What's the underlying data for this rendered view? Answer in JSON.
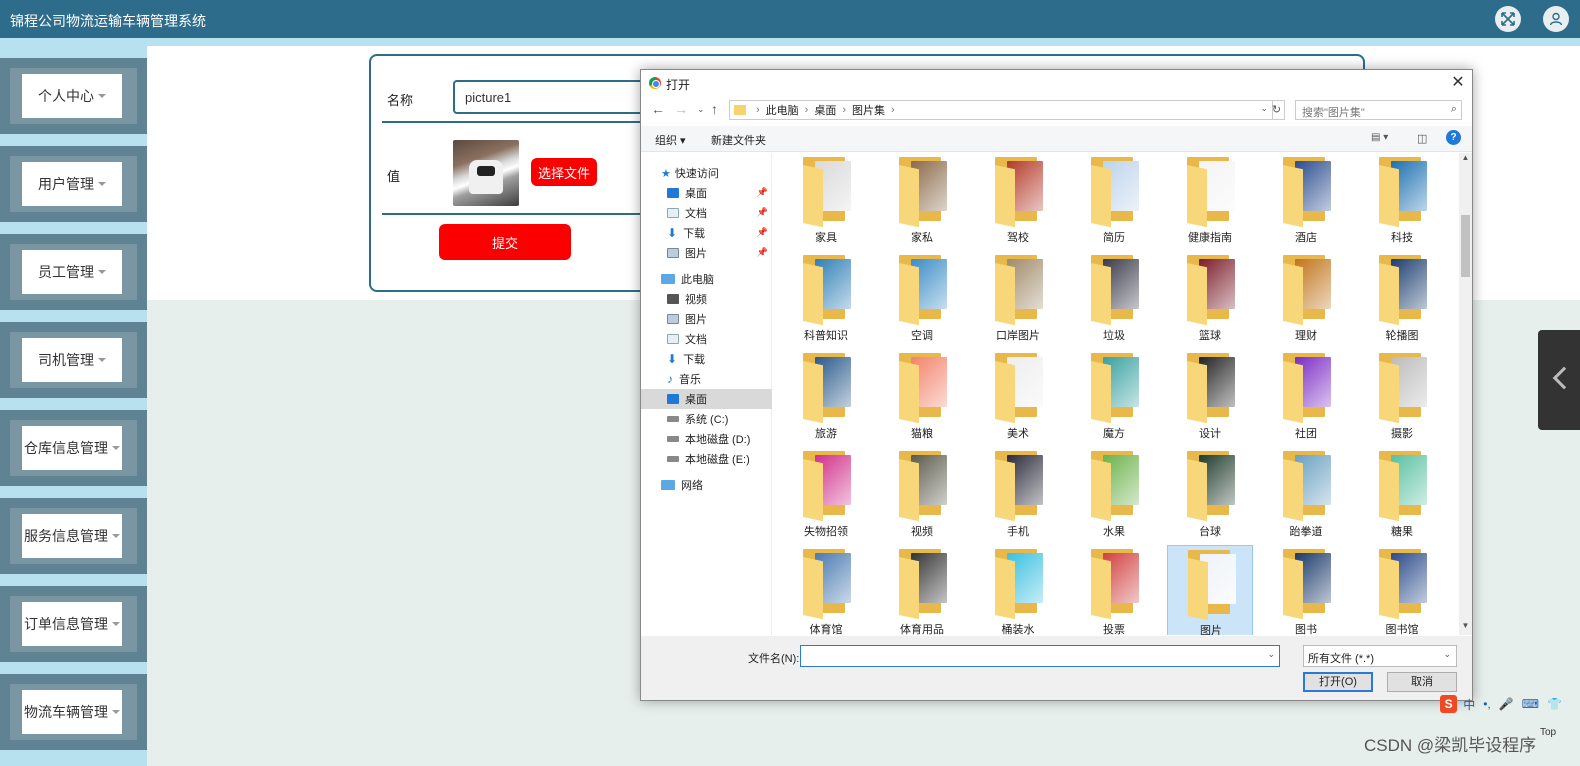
{
  "app": {
    "title": "锦程公司物流运输车辆管理系统"
  },
  "sidebar": {
    "items": [
      {
        "label": "个人中心"
      },
      {
        "label": "用户管理"
      },
      {
        "label": "员工管理"
      },
      {
        "label": "司机管理"
      },
      {
        "label": "仓库信息管理"
      },
      {
        "label": "服务信息管理"
      },
      {
        "label": "订单信息管理"
      },
      {
        "label": "物流车辆管理"
      }
    ]
  },
  "form": {
    "name_label": "名称",
    "name_value": "picture1",
    "value_label": "值",
    "choose_file": "选择文件",
    "submit": "提交"
  },
  "dialog": {
    "title": "打开",
    "breadcrumb": [
      "此电脑",
      "桌面",
      "图片集"
    ],
    "search_placeholder": "搜索\"图片集\"",
    "organize": "组织 ▾",
    "new_folder": "新建文件夹",
    "nav": [
      {
        "label": "快速访问",
        "icon": "star-icon",
        "pinned": false,
        "selected": false
      },
      {
        "label": "桌面",
        "icon": "desktop-icon",
        "pinned": true,
        "selected": false
      },
      {
        "label": "文档",
        "icon": "document-icon",
        "pinned": true,
        "selected": false
      },
      {
        "label": "下载",
        "icon": "download-icon",
        "pinned": true,
        "selected": false
      },
      {
        "label": "图片",
        "icon": "pictures-icon",
        "pinned": true,
        "selected": false
      },
      {
        "label": "此电脑",
        "icon": "computer-icon",
        "pinned": false,
        "selected": false
      },
      {
        "label": "视频",
        "icon": "video-icon",
        "pinned": false,
        "selected": false
      },
      {
        "label": "图片",
        "icon": "pictures-icon",
        "pinned": false,
        "selected": false
      },
      {
        "label": "文档",
        "icon": "document-icon",
        "pinned": false,
        "selected": false
      },
      {
        "label": "下载",
        "icon": "download-icon",
        "pinned": false,
        "selected": false
      },
      {
        "label": "音乐",
        "icon": "music-icon",
        "pinned": false,
        "selected": false
      },
      {
        "label": "桌面",
        "icon": "desktop-icon",
        "pinned": false,
        "selected": true
      },
      {
        "label": "系统 (C:)",
        "icon": "drive-icon",
        "pinned": false,
        "selected": false
      },
      {
        "label": "本地磁盘 (D:)",
        "icon": "drive-icon",
        "pinned": false,
        "selected": false
      },
      {
        "label": "本地磁盘 (E:)",
        "icon": "drive-icon",
        "pinned": false,
        "selected": false
      },
      {
        "label": "网络",
        "icon": "network-icon",
        "pinned": false,
        "selected": false
      }
    ],
    "folders": [
      {
        "label": "家具",
        "color": "#d9d9d9"
      },
      {
        "label": "家私",
        "color": "#8a6a4a"
      },
      {
        "label": "驾校",
        "color": "#b33a2a"
      },
      {
        "label": "简历",
        "color": "#bcd3ea"
      },
      {
        "label": "健康指南",
        "color": "#f4f4f4"
      },
      {
        "label": "酒店",
        "color": "#2b4c8e"
      },
      {
        "label": "科技",
        "color": "#1b6fb0"
      },
      {
        "label": "科普知识",
        "color": "#2f7fb6"
      },
      {
        "label": "空调",
        "color": "#3b8cc6"
      },
      {
        "label": "口岸图片",
        "color": "#a08a6a"
      },
      {
        "label": "垃圾",
        "color": "#3a3a4a"
      },
      {
        "label": "篮球",
        "color": "#7a1d2a"
      },
      {
        "label": "理财",
        "color": "#c0741a"
      },
      {
        "label": "轮播图",
        "color": "#1c3d6e"
      },
      {
        "label": "旅游",
        "color": "#2a5a8a"
      },
      {
        "label": "猫粮",
        "color": "#f2826b"
      },
      {
        "label": "美术",
        "color": "#eeeeee"
      },
      {
        "label": "魔方",
        "color": "#39a0a0"
      },
      {
        "label": "设计",
        "color": "#222222"
      },
      {
        "label": "社团",
        "color": "#7b2cc4"
      },
      {
        "label": "摄影",
        "color": "#bbbbbb"
      },
      {
        "label": "失物招领",
        "color": "#d0308a"
      },
      {
        "label": "视频",
        "color": "#5a5a4a"
      },
      {
        "label": "手机",
        "color": "#2a2a3a"
      },
      {
        "label": "水果",
        "color": "#6bb14a"
      },
      {
        "label": "台球",
        "color": "#1f3a2a"
      },
      {
        "label": "跆拳道",
        "color": "#6aa0c0"
      },
      {
        "label": "糖果",
        "color": "#58c0a0"
      },
      {
        "label": "体育馆",
        "color": "#4a7ab0"
      },
      {
        "label": "体育用品",
        "color": "#333333"
      },
      {
        "label": "桶装水",
        "color": "#39c0e0"
      },
      {
        "label": "投票",
        "color": "#d04040"
      },
      {
        "label": "图片",
        "color": "#eef3f8"
      },
      {
        "label": "图书",
        "color": "#1a3a6a"
      },
      {
        "label": "图书馆",
        "color": "#2a4a8a"
      }
    ],
    "selected_folder": "图片",
    "filename_label": "文件名(N):",
    "filename_value": "",
    "filter": "所有文件 (*.*)",
    "open_button": "打开(O)",
    "cancel_button": "取消"
  },
  "ime": {
    "logo": "S",
    "mode": "中"
  },
  "watermark": "CSDN @梁凯毕设程序",
  "top_link": "Top"
}
